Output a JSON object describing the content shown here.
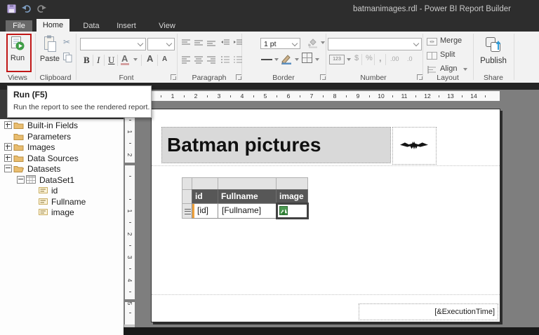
{
  "app": {
    "title": "batmanimages.rdl - Power BI Report Builder"
  },
  "tabs": {
    "file": "File",
    "home": "Home",
    "data": "Data",
    "insert": "Insert",
    "view": "View"
  },
  "ribbon": {
    "groups": {
      "views": "Views",
      "clipboard": "Clipboard",
      "font": "Font",
      "paragraph": "Paragraph",
      "border": "Border",
      "number": "Number",
      "layout": "Layout",
      "share": "Share"
    },
    "run": "Run",
    "paste": "Paste",
    "cut_icon": "✂",
    "bold": "B",
    "italic": "I",
    "underline": "U",
    "font_color": "A",
    "grow_font": "A",
    "shrink_font": "A",
    "border_width_value": "1 pt",
    "number_format_badge": "123",
    "currency": "$",
    "percent": "%",
    "comma": ",",
    "inc_decimal": ".00",
    "dec_decimal": ".0",
    "merge": "Merge",
    "split": "Split",
    "align": "Align",
    "publish": "Publish"
  },
  "tooltip": {
    "title": "Run (F5)",
    "body": "Run the report to see the rendered report."
  },
  "tree": {
    "items": [
      {
        "label": "Built-in Fields"
      },
      {
        "label": "Parameters"
      },
      {
        "label": "Images"
      },
      {
        "label": "Data Sources"
      },
      {
        "label": "Datasets"
      },
      {
        "label": "DataSet1"
      },
      {
        "label": "id"
      },
      {
        "label": "Fullname"
      },
      {
        "label": "image"
      }
    ]
  },
  "rulers": {
    "h": [
      "1",
      "2",
      "3",
      "4",
      "5",
      "6",
      "7",
      "8",
      "9",
      "10",
      "11",
      "12",
      "13",
      "14"
    ],
    "v_header": [
      "1",
      "2"
    ],
    "v_body": [
      "1",
      "2",
      "3",
      "4",
      "5"
    ]
  },
  "report": {
    "title": "Batman pictures",
    "table": {
      "headers": [
        "id",
        "Fullname",
        "image"
      ],
      "cells": [
        "[id]",
        "[Fullname]"
      ]
    },
    "footer": "[&ExecutionTime]"
  },
  "colors": {
    "accent_red": "#c11717",
    "header_cell": "#575757",
    "selection_orange": "#f0a23c",
    "run_green": "#3f9d46"
  }
}
